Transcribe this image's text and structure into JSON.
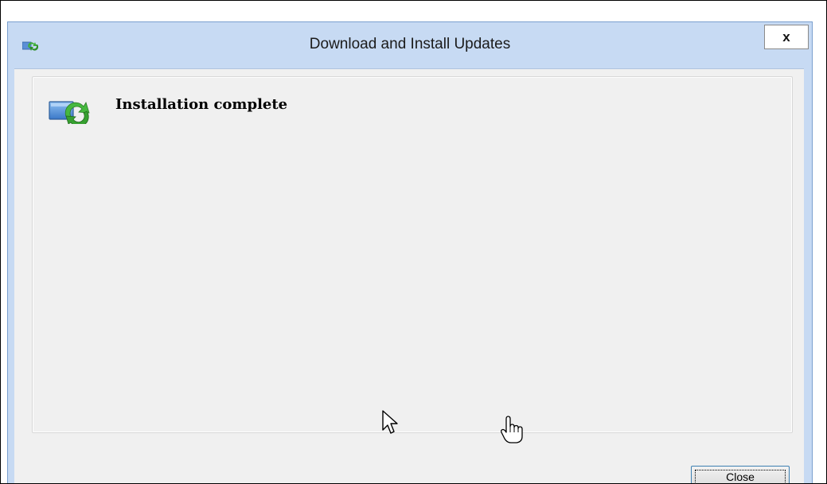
{
  "dialog": {
    "title": "Download and Install Updates",
    "title_icon": "windows-update-icon",
    "close_glyph": "x"
  },
  "content": {
    "status_icon": "windows-update-icon",
    "heading": "Installation complete"
  },
  "footer": {
    "close_label": "Close"
  },
  "cursors": {
    "arrow": "arrow-cursor-icon",
    "hand": "hand-pointer-cursor-icon"
  },
  "colors": {
    "frame": "#c7daf3",
    "client": "#f0f0f0",
    "focus_border": "#3c7fb1"
  }
}
